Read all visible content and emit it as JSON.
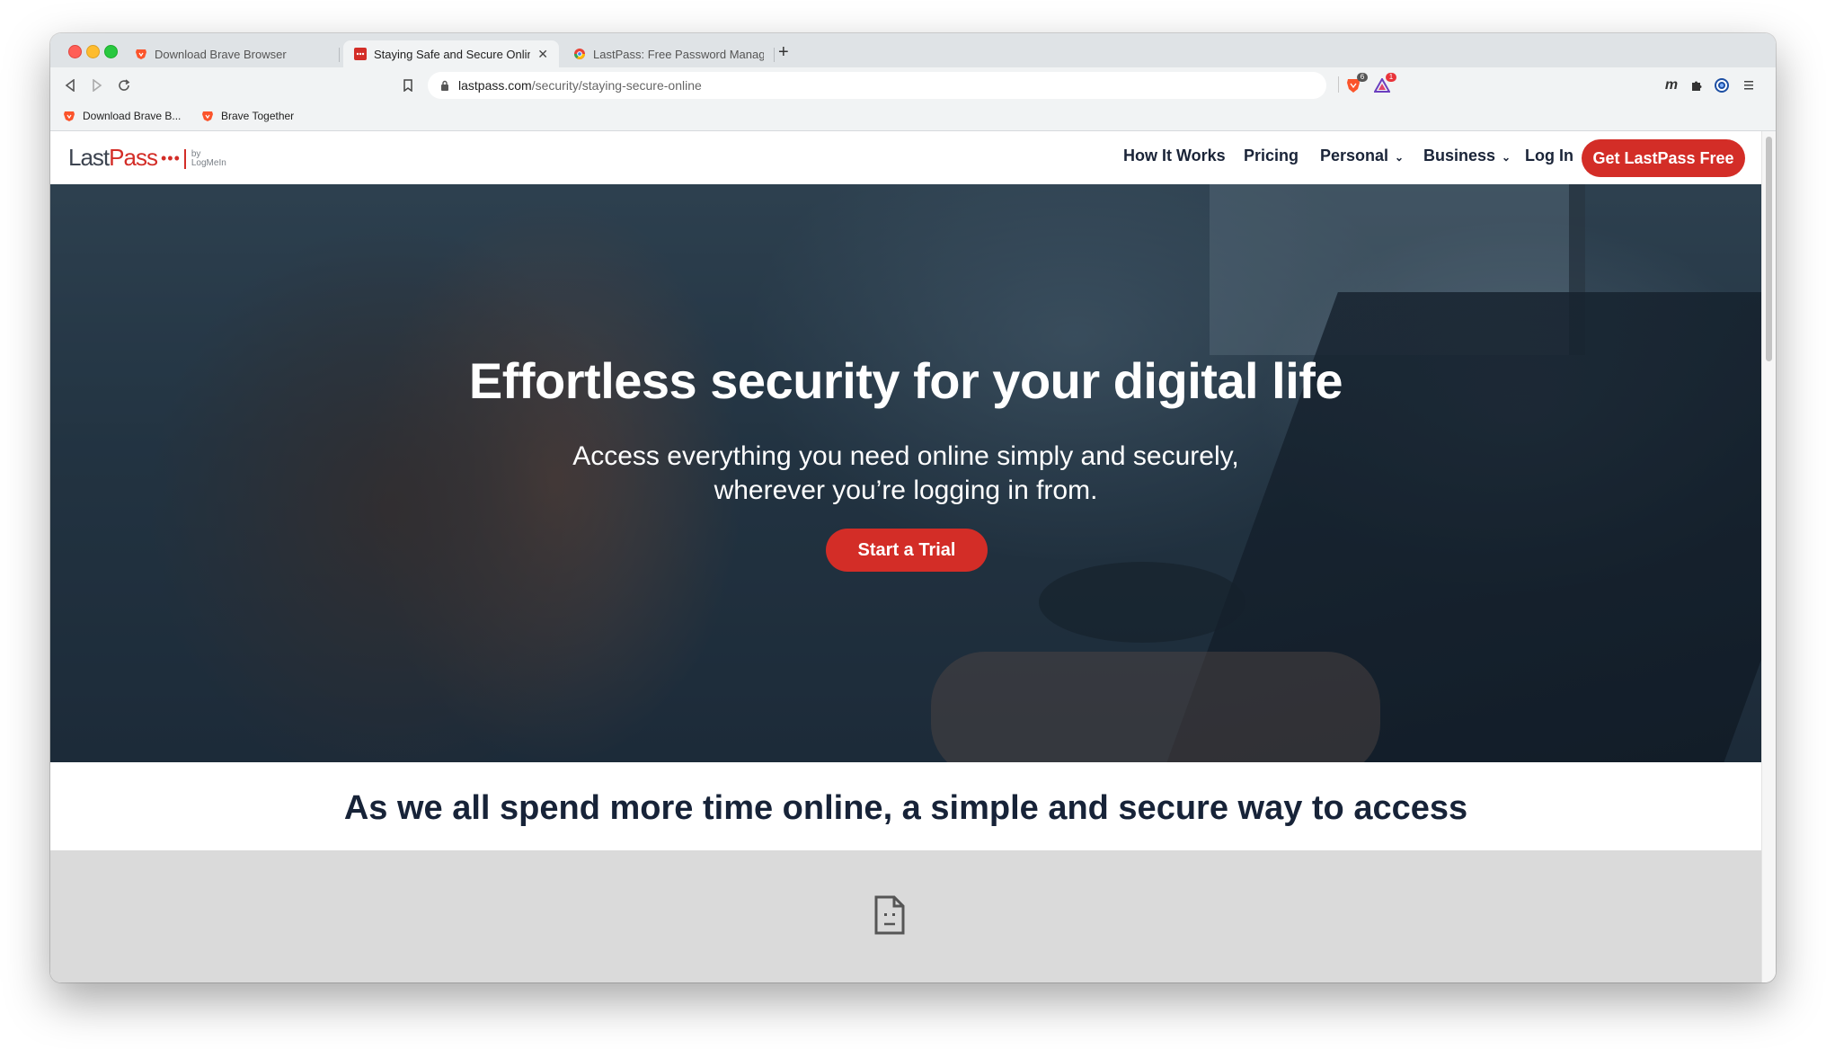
{
  "browser": {
    "tabs": [
      {
        "label": "Download Brave Browser",
        "active": false
      },
      {
        "label": "Staying Safe and Secure Online",
        "active": true
      },
      {
        "label": "LastPass: Free Password Manager",
        "active": false
      }
    ],
    "address": {
      "domain": "lastpass.com",
      "path": "/security/staying-secure-online"
    },
    "badges": {
      "shields_count": "6",
      "rewards_count": "1"
    },
    "extension_letter": "m",
    "bookmarks": [
      {
        "label": "Download Brave B..."
      },
      {
        "label": "Brave Together"
      }
    ]
  },
  "site": {
    "logo": {
      "last": "Last",
      "pass": "Pass",
      "dots": "•••",
      "by_line1": "by",
      "by_line2": "LogMeIn"
    },
    "nav": [
      {
        "label": "How It Works",
        "has_dropdown": false
      },
      {
        "label": "Pricing",
        "has_dropdown": false
      },
      {
        "label": "Personal",
        "has_dropdown": true
      },
      {
        "label": "Business",
        "has_dropdown": true
      },
      {
        "label": "Log In",
        "has_dropdown": false
      }
    ],
    "cta_label": "Get LastPass Free",
    "hero": {
      "title": "Effortless security for your digital life",
      "subtitle_line1": "Access everything you need online simply and securely,",
      "subtitle_line2": "wherever you’re logging in from.",
      "button_label": "Start a Trial"
    },
    "section_heading": "As we all spend more time online, a simple and secure way to access"
  },
  "colors": {
    "brand_red": "#d32d27",
    "nav_text": "#1a2438"
  }
}
